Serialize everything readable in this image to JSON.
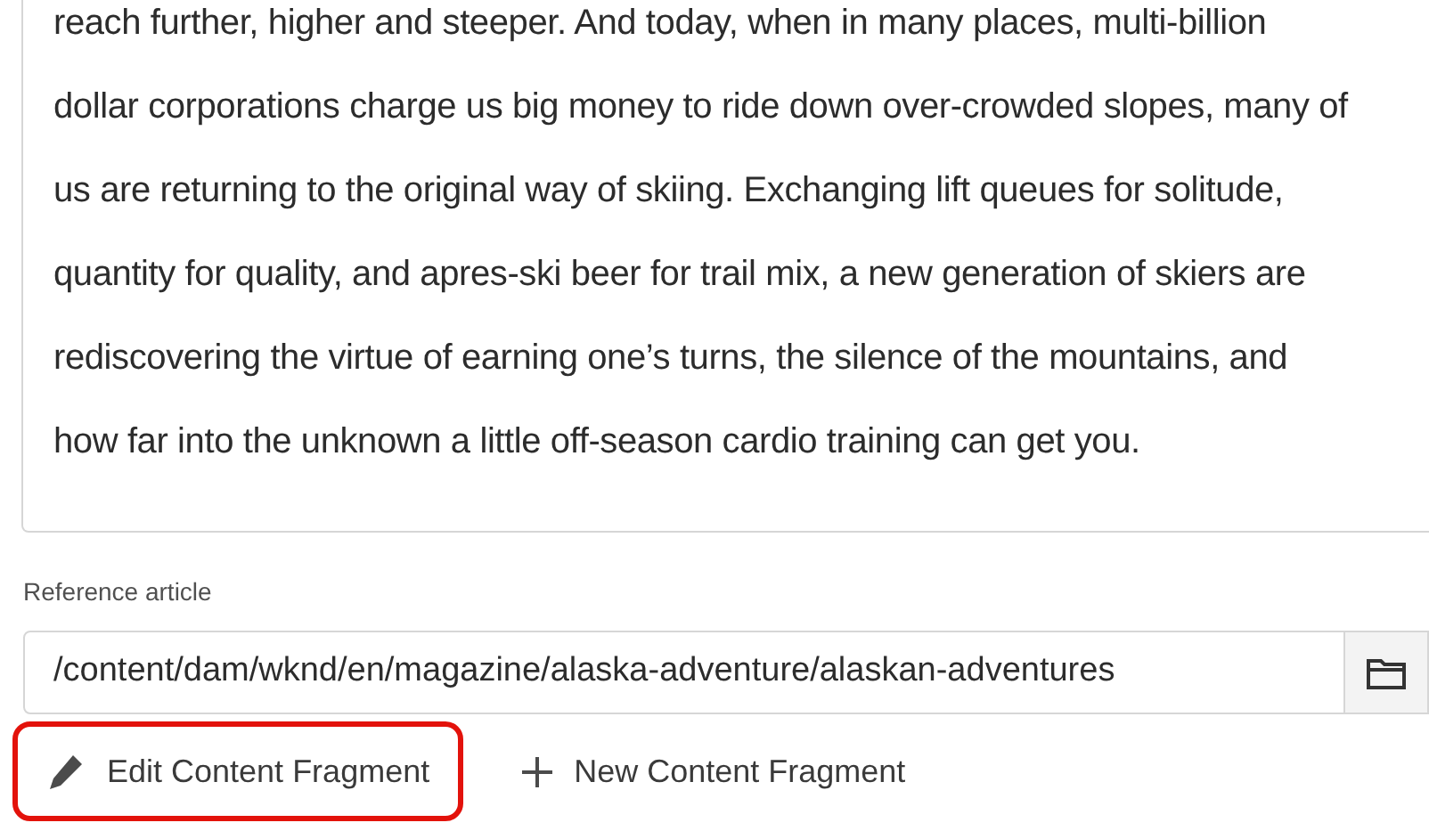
{
  "description": {
    "lines": [
      "reach further, higher and steeper. And today, when in many places, multi-billion",
      "dollar corporations charge us big money to ride down over-crowded slopes, many of",
      "us are returning to the original way of skiing. Exchanging lift queues for solitude,",
      "quantity for quality, and apres-ski beer for trail mix, a new generation of skiers are",
      "rediscovering the virtue of earning one’s turns, the silence of the mountains, and",
      "how far into the unknown a little off-season cardio training can get you."
    ]
  },
  "reference": {
    "label": "Reference article",
    "value": "/content/dam/wknd/en/magazine/alaska-adventure/alaskan-adventures"
  },
  "actions": [
    {
      "kind": "edit",
      "label": "Edit Content Fragment",
      "highlighted": true
    },
    {
      "kind": "new",
      "label": "New Content Fragment",
      "highlighted": false
    }
  ]
}
